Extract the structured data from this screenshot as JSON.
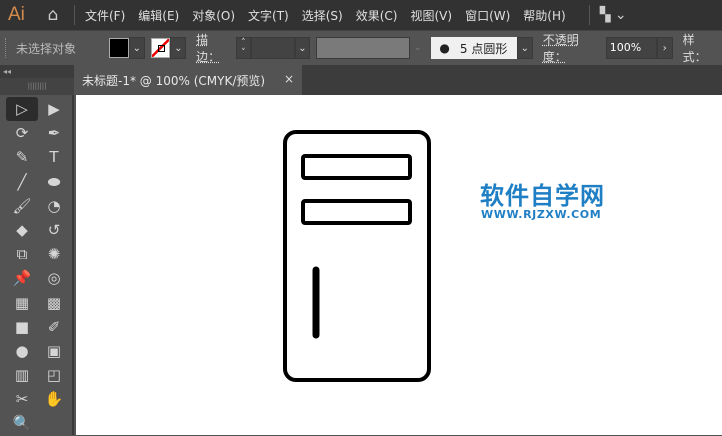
{
  "app": {
    "logo": "Ai",
    "home_icon": "home-icon"
  },
  "menu": [
    "文件(F)",
    "编辑(E)",
    "对象(O)",
    "文字(T)",
    "选择(S)",
    "效果(C)",
    "视图(V)",
    "窗口(W)",
    "帮助(H)"
  ],
  "control": {
    "selection": "未选择对象",
    "fill_color": "#000000",
    "stroke_label": "描边：",
    "brush": "5 点圆形",
    "opacity_label": "不透明度：",
    "opacity_value": "100%",
    "style_label": "样式："
  },
  "document_tab": {
    "title": "未标题-1* @ 100% (CMYK/预览)",
    "close": "×"
  },
  "tools": [
    {
      "name": "selection-tool",
      "glyph": "▷"
    },
    {
      "name": "direct-selection-tool",
      "glyph": "▶"
    },
    {
      "name": "lasso-tool",
      "glyph": "⟳"
    },
    {
      "name": "pen-tool",
      "glyph": "✒"
    },
    {
      "name": "curvature-tool",
      "glyph": "✎"
    },
    {
      "name": "type-tool",
      "glyph": "T"
    },
    {
      "name": "line-tool",
      "glyph": "╱"
    },
    {
      "name": "ellipse-tool",
      "glyph": "⬬"
    },
    {
      "name": "paintbrush-tool",
      "glyph": "🖌"
    },
    {
      "name": "blob-brush-tool",
      "glyph": "◔"
    },
    {
      "name": "eraser-tool",
      "glyph": "◆"
    },
    {
      "name": "rotate-tool",
      "glyph": "↺"
    },
    {
      "name": "scale-tool",
      "glyph": "⧉"
    },
    {
      "name": "warp-tool",
      "glyph": "✺"
    },
    {
      "name": "puppet-warp-tool",
      "glyph": "📌"
    },
    {
      "name": "shape-builder-tool",
      "glyph": "◎"
    },
    {
      "name": "perspective-grid-tool",
      "glyph": "▦"
    },
    {
      "name": "mesh-tool",
      "glyph": "▩"
    },
    {
      "name": "gradient-tool",
      "glyph": "■"
    },
    {
      "name": "eyedropper-tool",
      "glyph": "✐"
    },
    {
      "name": "blend-tool",
      "glyph": "●"
    },
    {
      "name": "symbol-sprayer-tool",
      "glyph": "▣"
    },
    {
      "name": "column-graph-tool",
      "glyph": "▥"
    },
    {
      "name": "artboard-tool",
      "glyph": "◰"
    },
    {
      "name": "slice-tool",
      "glyph": "✂"
    },
    {
      "name": "hand-tool",
      "glyph": "✋"
    },
    {
      "name": "zoom-tool",
      "glyph": "🔍"
    }
  ],
  "watermark": {
    "title": "软件自学网",
    "url": "WWW.RJZXW.COM",
    "color": "#1f7fc4"
  },
  "colors": {
    "menubar": "#323232",
    "panel": "#535353",
    "canvas": "#ffffff"
  }
}
